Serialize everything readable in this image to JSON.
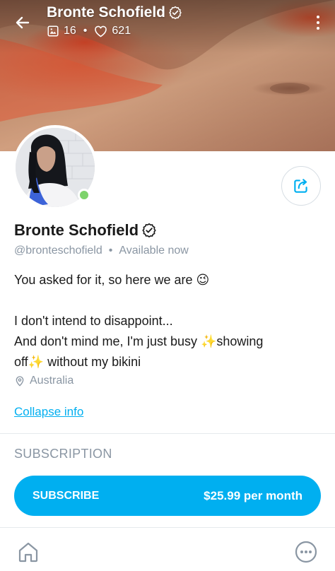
{
  "header": {
    "title": "Bronte Schofield",
    "media_count": "16",
    "likes_count": "621",
    "separator": "•"
  },
  "profile": {
    "name": "Bronte Schofield",
    "handle": "@bronteschofield",
    "handle_separator": "•",
    "status": "Available now",
    "bio_line1": "You asked for it, so here we are 😉",
    "bio_line2": "I don't intend to disappoint...",
    "bio_line3": "And don't mind me, I'm just busy ✨showing",
    "bio_line4": "off✨ without my bikini",
    "location": "Australia",
    "collapse_label": "Collapse info"
  },
  "subscription": {
    "heading": "SUBSCRIPTION",
    "button_label": "SUBSCRIBE",
    "price": "$25.99 per month"
  },
  "colors": {
    "accent": "#00aff0",
    "muted": "#8a96a3",
    "online": "#7dd36b"
  },
  "icons": {
    "back": "arrow-left-icon",
    "verified": "verified-badge-icon",
    "media": "image-icon",
    "likes": "heart-icon",
    "more": "vertical-dots-icon",
    "share": "share-icon",
    "location": "location-pin-icon",
    "home": "home-icon",
    "more_nav": "more-circle-icon"
  }
}
